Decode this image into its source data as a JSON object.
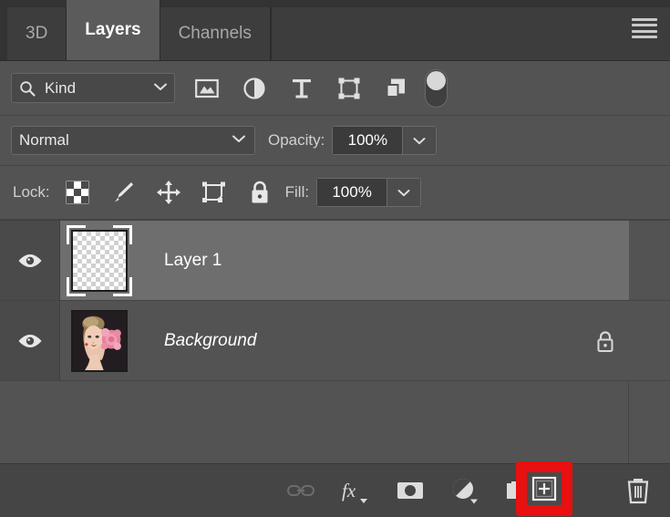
{
  "panel": {
    "tabs": [
      {
        "label": "3D",
        "active": false
      },
      {
        "label": "Layers",
        "active": true
      },
      {
        "label": "Channels",
        "active": false
      }
    ],
    "menu_icon": "hamburger-menu-icon"
  },
  "filter": {
    "kind_label": "Kind",
    "search_icon": "search-icon",
    "dropdown_icon": "chevron-down-icon",
    "type_filters": [
      {
        "name": "pixel-layer-filter-icon",
        "title": "Filter for pixel layers"
      },
      {
        "name": "adjustment-layer-filter-icon",
        "title": "Filter for adjustment layers"
      },
      {
        "name": "type-layer-filter-icon",
        "title": "Filter for type layers"
      },
      {
        "name": "shape-layer-filter-icon",
        "title": "Filter for shape layers"
      },
      {
        "name": "smart-object-filter-icon",
        "title": "Filter for smart objects"
      }
    ],
    "toggle_state": "on"
  },
  "blending": {
    "mode": "Normal",
    "opacity_label": "Opacity:",
    "opacity_value": "100%"
  },
  "lock": {
    "label": "Lock:",
    "items": [
      {
        "name": "lock-transparent-pixels-icon"
      },
      {
        "name": "lock-image-pixels-icon"
      },
      {
        "name": "lock-position-icon"
      },
      {
        "name": "lock-artboard-nesting-icon"
      },
      {
        "name": "lock-all-icon"
      }
    ],
    "fill_label": "Fill:",
    "fill_value": "100%"
  },
  "layers": [
    {
      "name": "Layer 1",
      "visible": true,
      "selected": true,
      "italic": false,
      "locked": false,
      "thumbnail": "transparent-checkerboard"
    },
    {
      "name": "Background",
      "visible": true,
      "selected": false,
      "italic": true,
      "locked": true,
      "thumbnail": "portrait-photo"
    }
  ],
  "bottom_bar": {
    "buttons": [
      {
        "name": "link-layers-button",
        "label": "Link layers",
        "dimmed": true
      },
      {
        "name": "layer-style-fx-button",
        "label": "Add a layer style",
        "dimmed": false
      },
      {
        "name": "add-layer-mask-button",
        "label": "Add layer mask",
        "dimmed": false
      },
      {
        "name": "new-adjustment-layer-button",
        "label": "Create new fill or adjustment layer",
        "dimmed": false
      },
      {
        "name": "new-group-button",
        "label": "Create a new group",
        "dimmed": false
      },
      {
        "name": "new-layer-button",
        "label": "Create a new layer",
        "dimmed": false,
        "highlighted": true
      },
      {
        "name": "delete-layer-button",
        "label": "Delete layer",
        "dimmed": false
      }
    ]
  },
  "annotation": {
    "highlight_color": "#e81010",
    "target": "new-layer-button"
  }
}
